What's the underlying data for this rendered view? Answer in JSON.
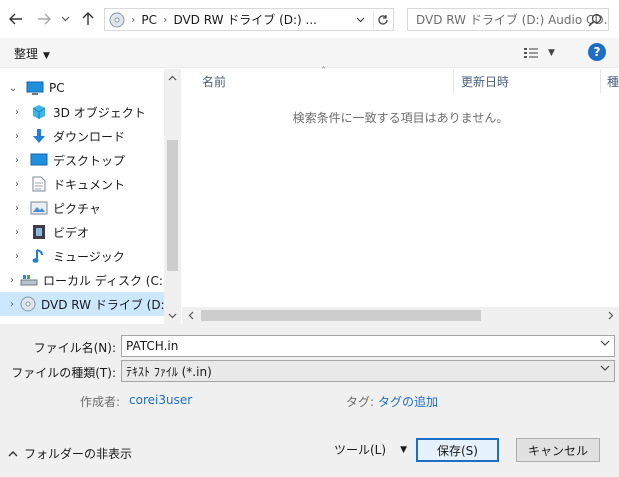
{
  "nav": {
    "back_icon": "arrow-left-icon",
    "forward_icon": "arrow-right-icon",
    "recent_icon": "chevron-down-icon",
    "up_icon": "arrow-up-icon"
  },
  "address": {
    "crumbs": [
      "PC",
      "DVD RW ドライブ (D:) ..."
    ],
    "search_placeholder": "DVD RW ドライブ (D:) Audio CD..."
  },
  "toolbar": {
    "organize_label": "整理",
    "help_label": "?"
  },
  "tree": {
    "items": [
      {
        "label": "PC",
        "icon": "pc-icon",
        "expanded": true
      },
      {
        "label": "3D オブジェクト",
        "icon": "3d-objects-icon"
      },
      {
        "label": "ダウンロード",
        "icon": "download-icon"
      },
      {
        "label": "デスクトップ",
        "icon": "desktop-icon"
      },
      {
        "label": "ドキュメント",
        "icon": "documents-icon"
      },
      {
        "label": "ピクチャ",
        "icon": "pictures-icon"
      },
      {
        "label": "ビデオ",
        "icon": "videos-icon"
      },
      {
        "label": "ミュージック",
        "icon": "music-icon"
      },
      {
        "label": "ローカル ディスク (C:)",
        "icon": "local-disk-icon"
      },
      {
        "label": "DVD RW ドライブ (D:) A",
        "icon": "dvd-drive-icon",
        "selected": true
      }
    ]
  },
  "filelist": {
    "columns": [
      "名前",
      "更新日時",
      "種"
    ],
    "empty_message": "検索条件に一致する項目はありません。"
  },
  "form": {
    "filename_label": "ファイル名(N):",
    "filename_value": "PATCH.in",
    "filetype_label": "ファイルの種類(T):",
    "filetype_value": "ﾃｷｽﾄ ﾌｧｲﾙ (*.in)",
    "author_label": "作成者:",
    "author_value": "corei3user",
    "tags_label": "タグ:",
    "tags_value": "タグの追加"
  },
  "footer": {
    "hide_folders_label": "フォルダーの非表示",
    "tools_label": "ツール(L)",
    "save_label": "保存(S)",
    "cancel_label": "キャンセル"
  },
  "colors": {
    "accent": "#1d6ec5",
    "selected_bg": "#cce8ff",
    "panel_bg": "#f0f0f0"
  }
}
